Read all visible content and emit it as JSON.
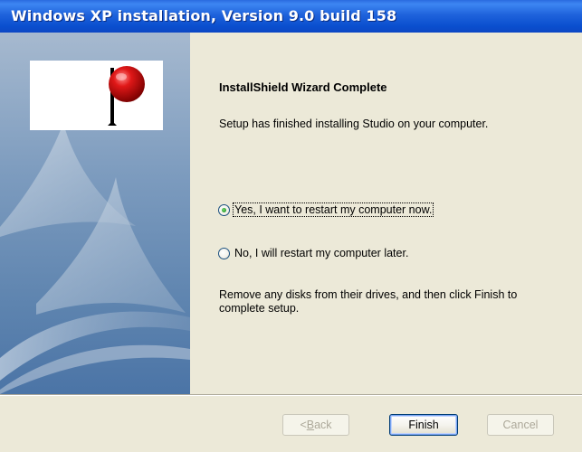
{
  "window": {
    "title": "Windows XP installation, Version 9.0 build 158"
  },
  "sidebar": {
    "logo_icon": "installshield-logo-icon"
  },
  "main": {
    "heading": "InstallShield Wizard Complete",
    "message": "Setup has finished installing Studio on your computer.",
    "restart_options": [
      {
        "label": "Yes, I want to restart my computer now.",
        "selected": true
      },
      {
        "label": "No, I will restart my computer later.",
        "selected": false
      }
    ],
    "remove_disks_message": "Remove any disks from their drives, and then click Finish to complete setup."
  },
  "buttons": {
    "back_prefix": "< ",
    "back_access_key": "B",
    "back_rest": "ack",
    "finish": "Finish",
    "cancel": "Cancel",
    "back_enabled": false,
    "finish_enabled": true,
    "cancel_enabled": false
  },
  "colors": {
    "titlebar": "#0A4FCF",
    "dialog_background": "#ECE9D8",
    "radio_selected": "#2F9A2F"
  }
}
